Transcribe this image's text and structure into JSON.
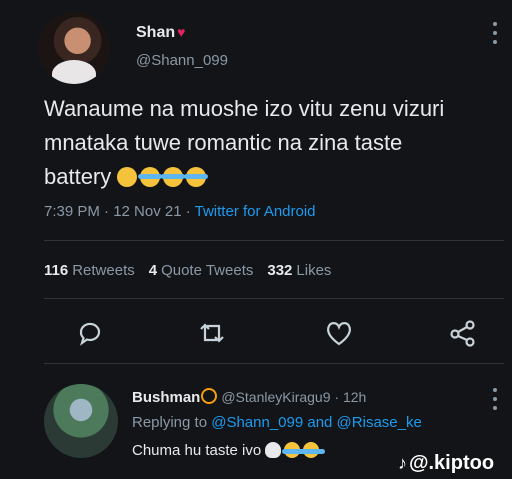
{
  "tweet": {
    "display_name": "Shan",
    "handle": "@Shann_099",
    "text_line1": "Wanaume na muoshe izo vitu zenu vizuri",
    "text_line2": "mnataka tuwe romantic na zina taste",
    "text_line3": "battery",
    "timestamp": "7:39 PM · 12 Nov 21 · ",
    "source": "Twitter for Android",
    "stats": {
      "retweets_count": "116",
      "retweets_label": "Retweets",
      "quotes_count": "4",
      "quotes_label": "Quote Tweets",
      "likes_count": "332",
      "likes_label": "Likes"
    },
    "icons": [
      "heart-icon",
      "more-icon",
      "reply-icon",
      "retweet-icon",
      "like-icon",
      "share-icon"
    ]
  },
  "reply": {
    "display_name": "Bushman",
    "handle_time": "@StanleyKiragu9 · 12h",
    "replying_prefix": "Replying to ",
    "replying_users": "@Shann_099 and @Risase_ke",
    "text": "Chuma hu taste ivo"
  },
  "watermark": {
    "note": "♪",
    "text": "@.kiptoo"
  },
  "colors": {
    "background": "#121418",
    "link": "#1d9bf0",
    "muted": "#8b98a5"
  }
}
